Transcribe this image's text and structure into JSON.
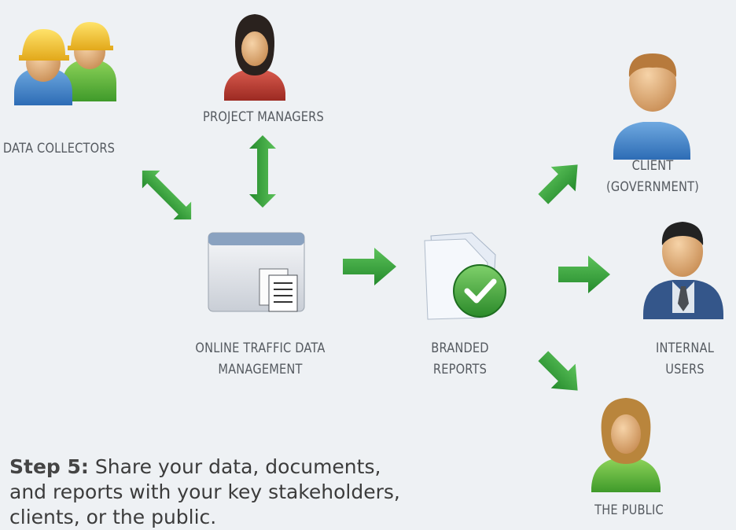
{
  "nodes": {
    "data_collectors": "DATA COLLECTORS",
    "project_managers": "PROJECT MANAGERS",
    "client_line1": "CLIENT",
    "client_line2": "(GOVERNMENT)",
    "online_line1": "ONLINE TRAFFIC DATA",
    "online_line2": "MANAGEMENT",
    "branded_line1": "BRANDED",
    "branded_line2": "REPORTS",
    "internal_line1": "INTERNAL",
    "internal_line2": "USERS",
    "public": "THE PUBLIC"
  },
  "caption": {
    "step": "Step 5:",
    "text": " Share your data, documents, and reports with your key stakeholders, clients, or the public."
  },
  "colors": {
    "background": "#eef1f4",
    "arrow": "#3a9a3a",
    "label": "#555a60"
  },
  "icons": [
    "worker-pair-icon",
    "person-female-icon",
    "person-male-icon",
    "window-documents-icon",
    "report-check-icon",
    "person-tie-icon",
    "person-blonde-icon"
  ]
}
